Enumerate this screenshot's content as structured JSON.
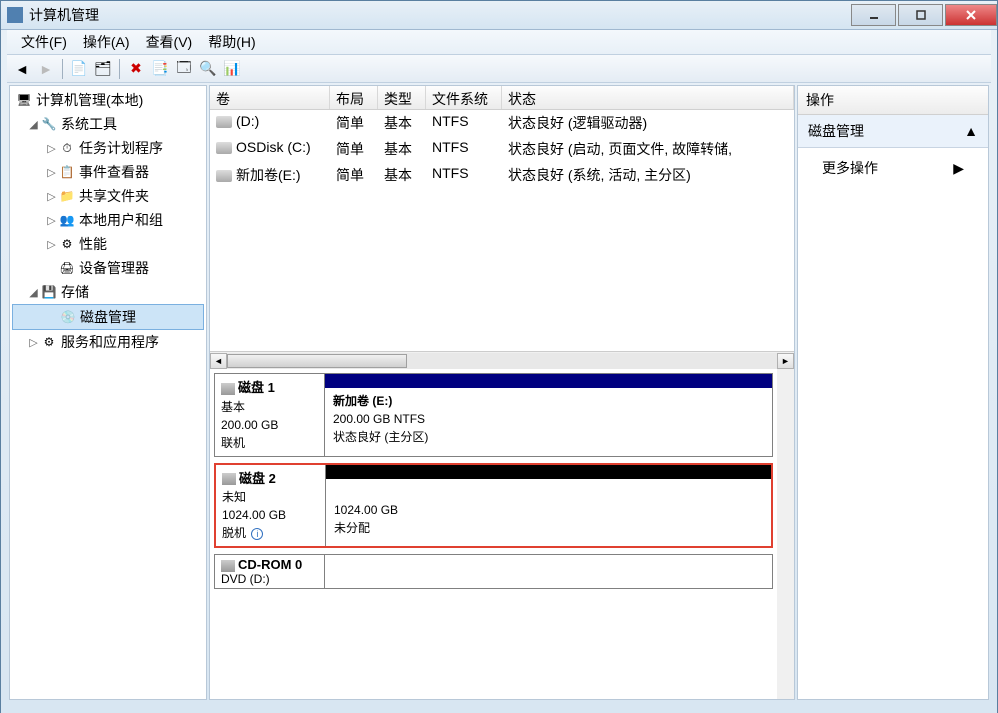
{
  "window": {
    "title": "计算机管理"
  },
  "menu": {
    "file": "文件(F)",
    "action": "操作(A)",
    "view": "查看(V)",
    "help": "帮助(H)"
  },
  "tree": {
    "root": "计算机管理(本地)",
    "systools": "系统工具",
    "scheduler": "任务计划程序",
    "eventviewer": "事件查看器",
    "shared": "共享文件夹",
    "users": "本地用户和组",
    "perf": "性能",
    "devmgr": "设备管理器",
    "storage": "存储",
    "diskmgmt": "磁盘管理",
    "services": "服务和应用程序"
  },
  "vol_headers": {
    "vol": "卷",
    "layout": "布局",
    "type": "类型",
    "fs": "文件系统",
    "status": "状态"
  },
  "volumes": [
    {
      "name": "(D:)",
      "layout": "简单",
      "type": "基本",
      "fs": "NTFS",
      "status": "状态良好 (逻辑驱动器)"
    },
    {
      "name": "OSDisk (C:)",
      "layout": "简单",
      "type": "基本",
      "fs": "NTFS",
      "status": "状态良好 (启动, 页面文件, 故障转储,"
    },
    {
      "name": "新加卷(E:)",
      "layout": "简单",
      "type": "基本",
      "fs": "NTFS",
      "status": "状态良好 (系统, 活动, 主分区)"
    }
  ],
  "disks": {
    "d1": {
      "title": "磁盘 1",
      "type": "基本",
      "size": "200.00 GB",
      "state": "联机",
      "part_title": "新加卷  (E:)",
      "part_size": "200.00 GB NTFS",
      "part_status": "状态良好 (主分区)"
    },
    "d2": {
      "title": "磁盘 2",
      "type": "未知",
      "size": "1024.00 GB",
      "state": "脱机",
      "part_size": "1024.00 GB",
      "part_status": "未分配"
    },
    "cd": {
      "title": "CD-ROM 0",
      "sub": "DVD (D:)"
    }
  },
  "actions": {
    "header": "操作",
    "diskmgmt": "磁盘管理",
    "more": "更多操作"
  }
}
